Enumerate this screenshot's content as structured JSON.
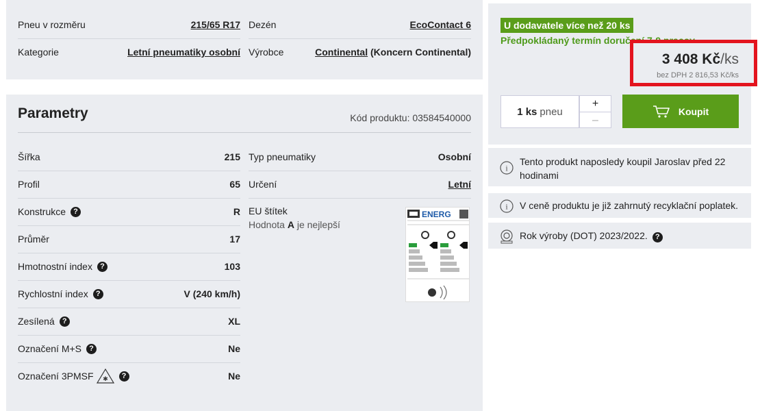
{
  "top": {
    "rows": [
      {
        "label": "Pneu v rozměru",
        "value": "215/65 R17"
      },
      {
        "label": "Kategorie",
        "value": "Letní pneumatiky osobní"
      }
    ],
    "rows_right": [
      {
        "label": "Dezén",
        "value": "EcoContact 6"
      },
      {
        "label": "Výrobce",
        "value": "Continental",
        "suffix": "(Koncern Continental)"
      }
    ]
  },
  "params": {
    "title": "Parametry",
    "code_label": "Kód produktu: 03584540000",
    "left": [
      {
        "label": "Šířka",
        "value": "215",
        "help": false
      },
      {
        "label": "Profil",
        "value": "65",
        "help": false
      },
      {
        "label": "Konstrukce",
        "value": "R",
        "help": true
      },
      {
        "label": "Průměr",
        "value": "17",
        "help": false
      },
      {
        "label": "Hmotnostní index",
        "value": "103",
        "help": true
      },
      {
        "label": "Rychlostní index",
        "value": "V (240 km/h)",
        "help": true
      },
      {
        "label": "Zesílená",
        "value": "XL",
        "help": true
      },
      {
        "label": "Označení M+S",
        "value": "Ne",
        "help": true
      },
      {
        "label": "Označení 3PMSF",
        "value": "Ne",
        "help": true
      }
    ],
    "right": [
      {
        "label": "Typ pneumatiky",
        "value": "Osobní"
      },
      {
        "label": "Určení",
        "value": "Letní"
      }
    ],
    "eu": {
      "label": "EU štítek",
      "note_pre": "Hodnota ",
      "note_bold": "A",
      "note_post": " je nejlepší",
      "energy_text": "ENERG"
    }
  },
  "buy": {
    "badge": "U dodavatele více než 20 ks",
    "delivery": "Předpokládaný termín doručení 7-9 pracov",
    "price": "3 408 Kč",
    "price_unit": "/ks",
    "price_net": "bez DPH 2 816,53 Kč/ks",
    "qty_number": "1 ks",
    "qty_unit": "pneu",
    "plus": "+",
    "minus": "–",
    "buy_label": "Koupit"
  },
  "info": [
    {
      "icon": "info-icon",
      "text": "Tento produkt naposledy koupil Jaroslav před 22 hodinami"
    },
    {
      "icon": "info-icon",
      "text": "V ceně produktu je již zahrnutý recyklační poplatek."
    },
    {
      "icon": "tire-icon",
      "text": "Rok výroby (DOT) 2023/2022."
    }
  ],
  "colors": {
    "accent_green": "#5a9d1a",
    "highlight_red": "#e3141e",
    "panel_bg": "#ebedf1"
  }
}
